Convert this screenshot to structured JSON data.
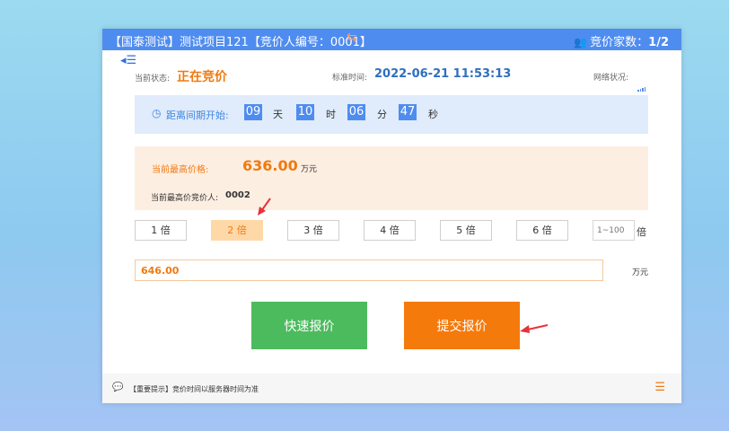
{
  "window": {
    "title": "【国泰测试】测试项目121【竞价人编号：0001】",
    "swap_icon": "swap-icon",
    "bidder_count_label": "竞价家数：",
    "bidder_count_value": "1/2"
  },
  "status": {
    "state_label": "当前状态:",
    "state_value": "正在竞价",
    "time_label": "标准时间:",
    "time_value": "2022-06-21 11:53:13",
    "network_label": "网络状况:"
  },
  "countdown": {
    "label": "距离间期开始:",
    "days": "09",
    "days_unit": "天",
    "hours": "10",
    "hours_unit": "时",
    "minutes": "06",
    "minutes_unit": "分",
    "seconds": "47",
    "seconds_unit": "秒"
  },
  "price": {
    "highest_label": "当前最高价格:",
    "highest_value": "636.00",
    "unit": "万元",
    "bidder_label": "当前最高价竞价人:",
    "bidder_value": "0002"
  },
  "multipliers": [
    "1 倍",
    "2 倍",
    "3 倍",
    "4 倍",
    "5 倍",
    "6 倍"
  ],
  "selected_multiplier": 1,
  "custom_multiplier": {
    "placeholder": "1~100",
    "unit": "倍"
  },
  "bid": {
    "value": "646.00",
    "unit": "万元"
  },
  "buttons": {
    "quick": "快速报价",
    "submit": "提交报价"
  },
  "footer": {
    "tip": "【重要提示】竞价时间以服务器时间为准"
  },
  "colors": {
    "accent_blue": "#4f8cf0",
    "accent_orange": "#f07a10",
    "green": "#4cbb5e",
    "arrow_red": "#e8323a"
  }
}
